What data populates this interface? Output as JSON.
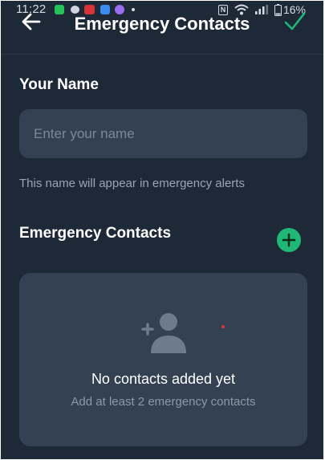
{
  "status_bar": {
    "time": "11:22",
    "battery_percent": "16%",
    "nfc_label": "N",
    "notification_icons": [
      "whatsapp-icon",
      "chat-bubble-icon",
      "red-app-icon",
      "blue-app-icon",
      "messenger-icon"
    ],
    "right_icons": [
      "nfc-icon",
      "wifi-icon",
      "signal-icon",
      "battery-icon"
    ]
  },
  "header": {
    "title": "Emergency Contacts",
    "back_icon": "arrow-left-icon",
    "confirm_icon": "checkmark-icon"
  },
  "name_section": {
    "label": "Your Name",
    "input_value": "",
    "input_placeholder": "Enter your name",
    "helper_text": "This name will appear in emergency alerts"
  },
  "contacts_section": {
    "label": "Emergency Contacts",
    "add_icon": "plus-icon",
    "empty_state": {
      "icon": "add-person-icon",
      "title": "No contacts added yet",
      "subtitle": "Add at least 2 emergency contacts"
    }
  },
  "colors": {
    "background": "#1e2938",
    "surface": "#344153",
    "accent_green": "#1fb877",
    "text_primary": "#ffffff",
    "text_secondary": "#9aa5b4"
  }
}
